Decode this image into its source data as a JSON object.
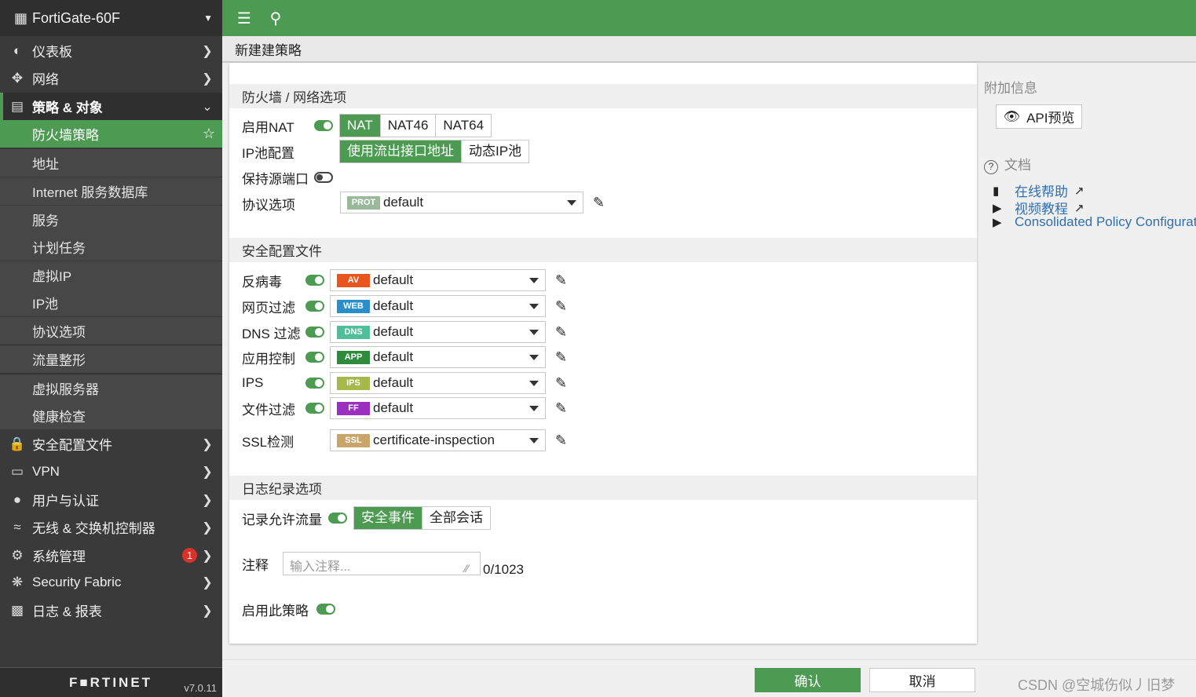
{
  "app": {
    "device_name": "FortiGate-60F",
    "brand": "F■RTINET",
    "version": "v7.0.11"
  },
  "sidebar": {
    "items": [
      {
        "label": "仪表板",
        "icon": "dashboard-icon"
      },
      {
        "label": "网络",
        "icon": "network-icon"
      },
      {
        "label": "策略 & 对象",
        "icon": "policy-icon"
      },
      {
        "label": "安全配置文件",
        "icon": "lock-icon"
      },
      {
        "label": "VPN",
        "icon": "laptop-icon"
      },
      {
        "label": "用户与认证",
        "icon": "user-icon"
      },
      {
        "label": "无线 & 交换机控制器",
        "icon": "wifi-icon"
      },
      {
        "label": "系统管理",
        "icon": "gear-icon",
        "badge": "1"
      },
      {
        "label": "Security Fabric",
        "icon": "fabric-icon"
      },
      {
        "label": "日志 & 报表",
        "icon": "chart-icon"
      }
    ],
    "subitems": [
      "防火墙策略",
      "地址",
      "Internet 服务数据库",
      "服务",
      "计划任务",
      "虚拟IP",
      "IP池",
      "协议选项",
      "流量整形",
      "虚拟服务器",
      "健康检查"
    ]
  },
  "header": {
    "page_title": "新建建策略"
  },
  "firewall": {
    "title": "防火墙 / 网络选项",
    "nat_label": "启用NAT",
    "nat_options": [
      "NAT",
      "NAT46",
      "NAT64"
    ],
    "ippool_label": "IP池配置",
    "ippool_options": [
      "使用流出接口地址",
      "动态IP池"
    ],
    "keep_port_label": "保持源端口",
    "proto_label": "协议选项",
    "proto_tag": "PROT",
    "proto_value": "default"
  },
  "security": {
    "title": "安全配置文件",
    "rows": [
      {
        "label": "反病毒",
        "tag": "AV",
        "value": "default",
        "color": "#e8561e"
      },
      {
        "label": "网页过滤",
        "tag": "WEB",
        "value": "default",
        "color": "#2a8fc9"
      },
      {
        "label": "DNS 过滤",
        "tag": "DNS",
        "value": "default",
        "color": "#4fbf9a"
      },
      {
        "label": "应用控制",
        "tag": "APP",
        "value": "default",
        "color": "#2e8b3c"
      },
      {
        "label": "IPS",
        "tag": "IPS",
        "value": "default",
        "color": "#a6b84a"
      },
      {
        "label": "文件过滤",
        "tag": "FF",
        "value": "default",
        "color": "#9b2fbf"
      }
    ],
    "ssl_label": "SSL检测",
    "ssl_tag": "SSL",
    "ssl_value": "certificate-inspection",
    "ssl_color": "#c9a56a"
  },
  "logging": {
    "title": "日志纪录选项",
    "log_label": "记录允许流量",
    "log_options": [
      "安全事件",
      "全部会话"
    ],
    "comment_label": "注释",
    "comment_placeholder": "输入注释...",
    "comment_count": "0/1023",
    "enable_label": "启用此策略"
  },
  "info": {
    "title": "附加信息",
    "api_button": "API预览",
    "docs_title": "文档",
    "links": [
      {
        "label": "在线帮助",
        "icon": "book-icon"
      },
      {
        "label": "视频教程",
        "icon": "video-icon"
      },
      {
        "label": "Consolidated Policy Configurat",
        "icon": "video-icon"
      }
    ]
  },
  "footer": {
    "ok": "确认",
    "cancel": "取消",
    "watermark": "CSDN @空城伤似丿旧梦"
  }
}
